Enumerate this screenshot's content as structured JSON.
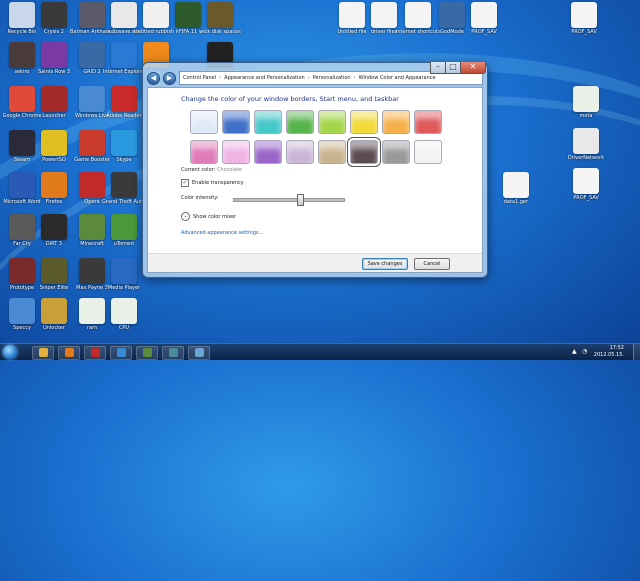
{
  "window": {
    "breadcrumb": [
      "Control Panel",
      "Appearance and Personalization",
      "Personalization",
      "Window Color and Appearance"
    ],
    "heading": "Change the color of your window borders, Start menu, and taskbar",
    "current_color_label": "Current color:",
    "current_color_value": "Chocolate",
    "transparency_label": "Enable transparency",
    "transparency_checked": true,
    "intensity_label": "Color intensity:",
    "intensity_fraction": 0.6,
    "mixer_label": "Show color mixer",
    "advanced_link": "Advanced appearance settings...",
    "save_label": "Save changes",
    "cancel_label": "Cancel",
    "swatch_colors": [
      "#dfe9f7",
      "#3f6fc9",
      "#45c8c8",
      "#56b44a",
      "#a4d548",
      "#f2d93a",
      "#f6b04a",
      "#e0585a",
      "#e07ab8",
      "#f0b3e4",
      "#9a64c8",
      "#cbb6d8",
      "#c9b48f",
      "#5a4a52",
      "#9a9a9a",
      "#f3f3f3"
    ],
    "selected_swatch": 13
  },
  "desktop": {
    "icons": [
      {
        "label": "Recycle Bin",
        "color": "#c8d8ea"
      },
      {
        "label": "Crysis 2",
        "color": "#3a3a3a"
      },
      {
        "label": "Batman Arkham City",
        "color": "#5a5a6a"
      },
      {
        "label": "autosave.sav",
        "color": "#e8e8e8"
      },
      {
        "label": "Untitled rubbish item",
        "color": "#f0f0f0"
      },
      {
        "label": "FIFA 11",
        "color": "#2d5a2d"
      },
      {
        "label": "wick disk spaces",
        "color": "#6a5a2a"
      },
      {
        "label": "sekiro",
        "color": "#4a3a3a"
      },
      {
        "label": "Saints Row 3",
        "color": "#7a3aa5"
      },
      {
        "label": "GRID 2",
        "color": "#3a6aa5"
      },
      {
        "label": "Internet Explorer",
        "color": "#2a7ad5"
      },
      {
        "label": "VLC",
        "color": "#f08a1a"
      },
      {
        "label": "Need for Speed",
        "color": "#222"
      },
      {
        "label": "Google Chrome",
        "color": "#e04a3a"
      },
      {
        "label": "Launcher",
        "color": "#a52a2a"
      },
      {
        "label": "Windows Live",
        "color": "#4a8ad5"
      },
      {
        "label": "Adobe Reader",
        "color": "#c82a2a"
      },
      {
        "label": "Steam",
        "color": "#2a2a3a"
      },
      {
        "label": "PowerISO",
        "color": "#e0c020"
      },
      {
        "label": "Game Booster",
        "color": "#c83a2a"
      },
      {
        "label": "Skype",
        "color": "#2a9ae0"
      },
      {
        "label": "Microsoft Word",
        "color": "#2a5ab5"
      },
      {
        "label": "Firefox",
        "color": "#e07a1a"
      },
      {
        "label": "Opera",
        "color": "#c02a2a"
      },
      {
        "label": "Grand Theft Auto IV",
        "color": "#3a3a3a"
      },
      {
        "label": "Far Cry",
        "color": "#5a5a5a"
      },
      {
        "label": "DiRT 3",
        "color": "#2a2a2a"
      },
      {
        "label": "Minecraft",
        "color": "#5a8a3a"
      },
      {
        "label": "uTorrent",
        "color": "#4a9a3a"
      },
      {
        "label": "Prototype",
        "color": "#7a2a2a"
      },
      {
        "label": "Sniper Elite",
        "color": "#5a5a2a"
      },
      {
        "label": "Max Payne 3",
        "color": "#3a3a3a"
      },
      {
        "label": "Media Player",
        "color": "#2a6ac5"
      },
      {
        "label": "Speccy",
        "color": "#4a8ad5"
      },
      {
        "label": "Unlocker",
        "color": "#c8a03a"
      },
      {
        "label": "ram",
        "color": "#e8f0e8"
      },
      {
        "label": "CPU",
        "color": "#e8f0e8"
      },
      {
        "label": "Untitled file",
        "color": "#f4f4f4"
      },
      {
        "label": "driver files",
        "color": "#f4f4f4"
      },
      {
        "label": "internet shortcuts",
        "color": "#f4f4f4"
      },
      {
        "label": "GodMode",
        "color": "#3a6aa5"
      },
      {
        "label": "PROF_SAV",
        "color": "#f4f4f4"
      },
      {
        "label": "PROF_SAV",
        "color": "#f4f4f4"
      },
      {
        "label": "meta",
        "color": "#e8f0e8"
      },
      {
        "label": "DriverNetwork",
        "color": "#e8e8e8"
      },
      {
        "label": "PROF_SAV",
        "color": "#f4f4f4"
      },
      {
        "label": "data1.ger",
        "color": "#f4f4f4"
      }
    ]
  },
  "taskbar": {
    "apps": [
      {
        "name": "explorer",
        "color": "#e0b040"
      },
      {
        "name": "firefox",
        "color": "#e07a1a"
      },
      {
        "name": "mycloud",
        "color": "#c02a2a"
      },
      {
        "name": "media",
        "color": "#3a8ad5"
      },
      {
        "name": "minecraft",
        "color": "#5a8a3a"
      },
      {
        "name": "grid",
        "color": "#4a8a9a"
      },
      {
        "name": "control-panel",
        "color": "#6aa5d5"
      }
    ],
    "time": "17:52",
    "date": "2012.05.15."
  }
}
